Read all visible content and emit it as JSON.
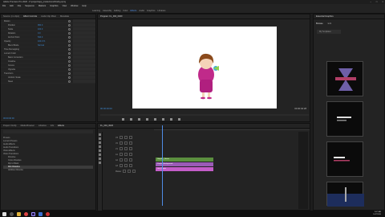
{
  "window": {
    "title": "Adobe Premiere Pro 2020 - F:\\project\\app_productions\\Firefly.prproj"
  },
  "menu": [
    "File",
    "Edit",
    "Clip",
    "Sequence",
    "Markers",
    "Graphics",
    "View",
    "Window",
    "Help"
  ],
  "workspaces": [
    "Learning",
    "Assembly",
    "Editing",
    "Color",
    "Effects",
    "Audio",
    "Graphics",
    "Libraries"
  ],
  "effect_controls": {
    "tabs": [
      "Source: (no clips)",
      "Effect Controls",
      "Audio Clip Mixer",
      "Metadata"
    ],
    "rows": [
      "Motion",
      "Position",
      "Scale",
      "Rotation",
      "Anchor Point",
      "Opacity",
      "Blend Mode",
      "Time Remapping",
      "Lumetri Color",
      "Basic Correction",
      "Creative",
      "Curves",
      "Vignette",
      "Transform",
      "Uniform Scale",
      "Skew"
    ],
    "values": [
      "",
      "960.0",
      "100.0",
      "0.0",
      "540.0",
      "100.0 %",
      "Normal",
      "",
      "",
      "",
      "",
      "",
      "",
      "",
      "",
      ""
    ],
    "timecode": "00:00:00:00"
  },
  "program": {
    "tab": "Program: FL_004_0020",
    "timecode_left": "00:00:00:00",
    "timecode_right": "00:00:04:28"
  },
  "right_panel": {
    "tabs": [
      "Essential Graphics",
      "Browse",
      "Edit"
    ],
    "button": "My Templates"
  },
  "project": {
    "tabs": [
      "Project: Firefly",
      "Media Browser",
      "Libraries",
      "Info",
      "Effects"
    ],
    "tree": [
      "Presets",
      "Lumetri Presets",
      "Audio Effects",
      "Audio Transitions",
      "Video Effects",
      "Video Transitions",
      "Dissolve",
      "Cross Dissolve",
      "Dip to Black",
      "Film Dissolve",
      "Additive Dissolve"
    ],
    "selected_index": 9
  },
  "timeline": {
    "tab": "FL_004_0020",
    "tracks": [
      "V3",
      "V2",
      "V1",
      "A1",
      "A2",
      "A3",
      "Master"
    ],
    "clips": [
      {
        "label": "Graphic_Green",
        "color": "#5b8f3e"
      },
      {
        "label": "Purple_Background",
        "color": "#9a5bb6"
      },
      {
        "label": "Girl_Purple",
        "color": "#c45dc8"
      }
    ]
  },
  "taskbar": {
    "time": "9:07 AM",
    "date": "10/7/2020"
  }
}
